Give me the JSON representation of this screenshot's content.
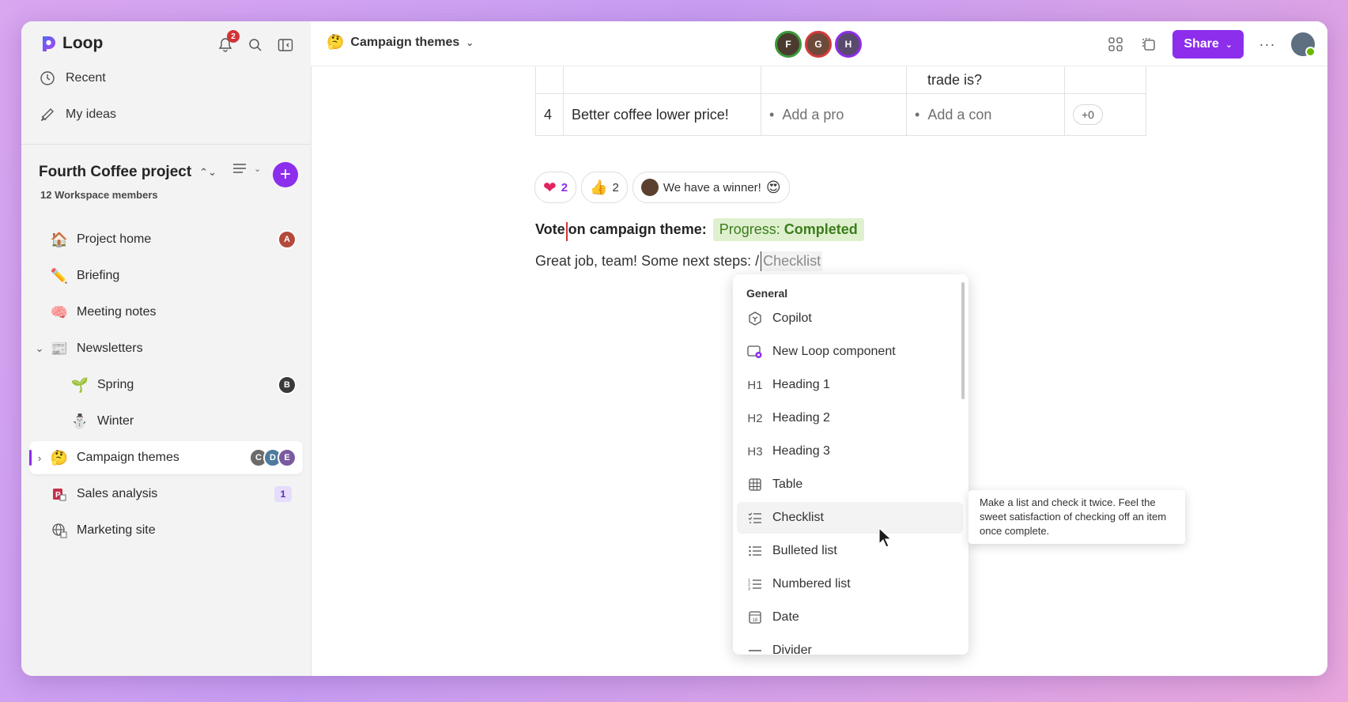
{
  "app": {
    "name": "Loop",
    "notification_count": "2"
  },
  "sidebar": {
    "nav": [
      {
        "label": "Recent"
      },
      {
        "label": "My ideas"
      }
    ],
    "workspace": {
      "title": "Fourth Coffee project",
      "members": "12 Workspace members"
    },
    "pages": [
      {
        "label": "Project home",
        "icon": "house-emoji"
      },
      {
        "label": "Briefing",
        "icon": "pencil-emoji"
      },
      {
        "label": "Meeting notes",
        "icon": "brain-emoji"
      },
      {
        "label": "Newsletters",
        "icon": "newspaper-emoji"
      },
      {
        "label": "Spring",
        "icon": "seedling-emoji"
      },
      {
        "label": "Winter",
        "icon": "snowman-emoji"
      },
      {
        "label": "Campaign themes",
        "icon": "thinking-face-emoji"
      },
      {
        "label": "Sales analysis",
        "icon": "powerpoint-icon",
        "badge": "1"
      },
      {
        "label": "Marketing site",
        "icon": "globe-icon"
      }
    ]
  },
  "header": {
    "doc_title": "Campaign themes",
    "share_label": "Share"
  },
  "doc": {
    "table": {
      "row_partial_text": "trade is?",
      "row_number": "4",
      "row_idea": "Better coffee lower price!",
      "pro_placeholder": "Add a pro",
      "con_placeholder": "Add a con",
      "votes": "+0"
    },
    "reactions": [
      {
        "emoji": "heart",
        "count": "2"
      },
      {
        "emoji": "thumbs-up",
        "count": "2"
      },
      {
        "label": "We have a winner!"
      }
    ],
    "vote_prefix": "Vote",
    "vote_suffix": "on campaign theme:",
    "progress_label": "Progress:",
    "progress_value": "Completed",
    "next_steps_text": "Great job, team! Some next steps: /",
    "slash_query": "Checklist"
  },
  "menu": {
    "section": "General",
    "items": [
      {
        "label": "Copilot",
        "icon": "copilot-icon"
      },
      {
        "label": "New Loop component",
        "icon": "loop-component-icon"
      },
      {
        "label": "Heading 1",
        "icon": "H1"
      },
      {
        "label": "Heading 2",
        "icon": "H2"
      },
      {
        "label": "Heading 3",
        "icon": "H3"
      },
      {
        "label": "Table",
        "icon": "table-icon"
      },
      {
        "label": "Checklist",
        "icon": "checklist-icon"
      },
      {
        "label": "Bulleted list",
        "icon": "bulleted-list-icon"
      },
      {
        "label": "Numbered list",
        "icon": "numbered-list-icon"
      },
      {
        "label": "Date",
        "icon": "calendar-icon"
      },
      {
        "label": "Divider",
        "icon": "divider-icon"
      }
    ],
    "tooltip": "Make a list and check it twice. Feel the sweet satisfaction of checking off an item once complete."
  },
  "colors": {
    "accent": "#8c2eec",
    "progress_bg": "#dff0cf",
    "progress_text": "#3b7d1c"
  }
}
